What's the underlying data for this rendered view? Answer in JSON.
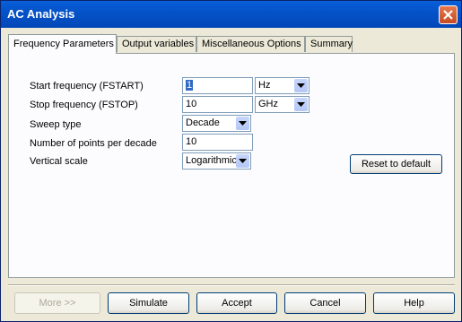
{
  "window": {
    "title": "AC Analysis"
  },
  "tabs": [
    {
      "label": "Frequency Parameters",
      "active": true
    },
    {
      "label": "Output variables",
      "active": false
    },
    {
      "label": "Miscellaneous Options",
      "active": false
    },
    {
      "label": "Summary",
      "active": false
    }
  ],
  "form": {
    "start_freq": {
      "label": "Start frequency (FSTART)",
      "value": "1",
      "unit": "Hz"
    },
    "stop_freq": {
      "label": "Stop frequency (FSTOP)",
      "value": "10",
      "unit": "GHz"
    },
    "sweep_type": {
      "label": "Sweep type",
      "value": "Decade"
    },
    "points": {
      "label": "Number of points per decade",
      "value": "10"
    },
    "vertical_scale": {
      "label": "Vertical scale",
      "value": "Logarithmic"
    },
    "reset_label": "Reset to default"
  },
  "buttons": {
    "more": "More >>",
    "simulate": "Simulate",
    "accept": "Accept",
    "cancel": "Cancel",
    "help": "Help"
  },
  "icons": {
    "close": "close-icon",
    "dropdown": "chevron-down-icon"
  },
  "colors": {
    "titlebar": "#0453c9",
    "close": "#c74a22",
    "selection": "#316ac5"
  }
}
